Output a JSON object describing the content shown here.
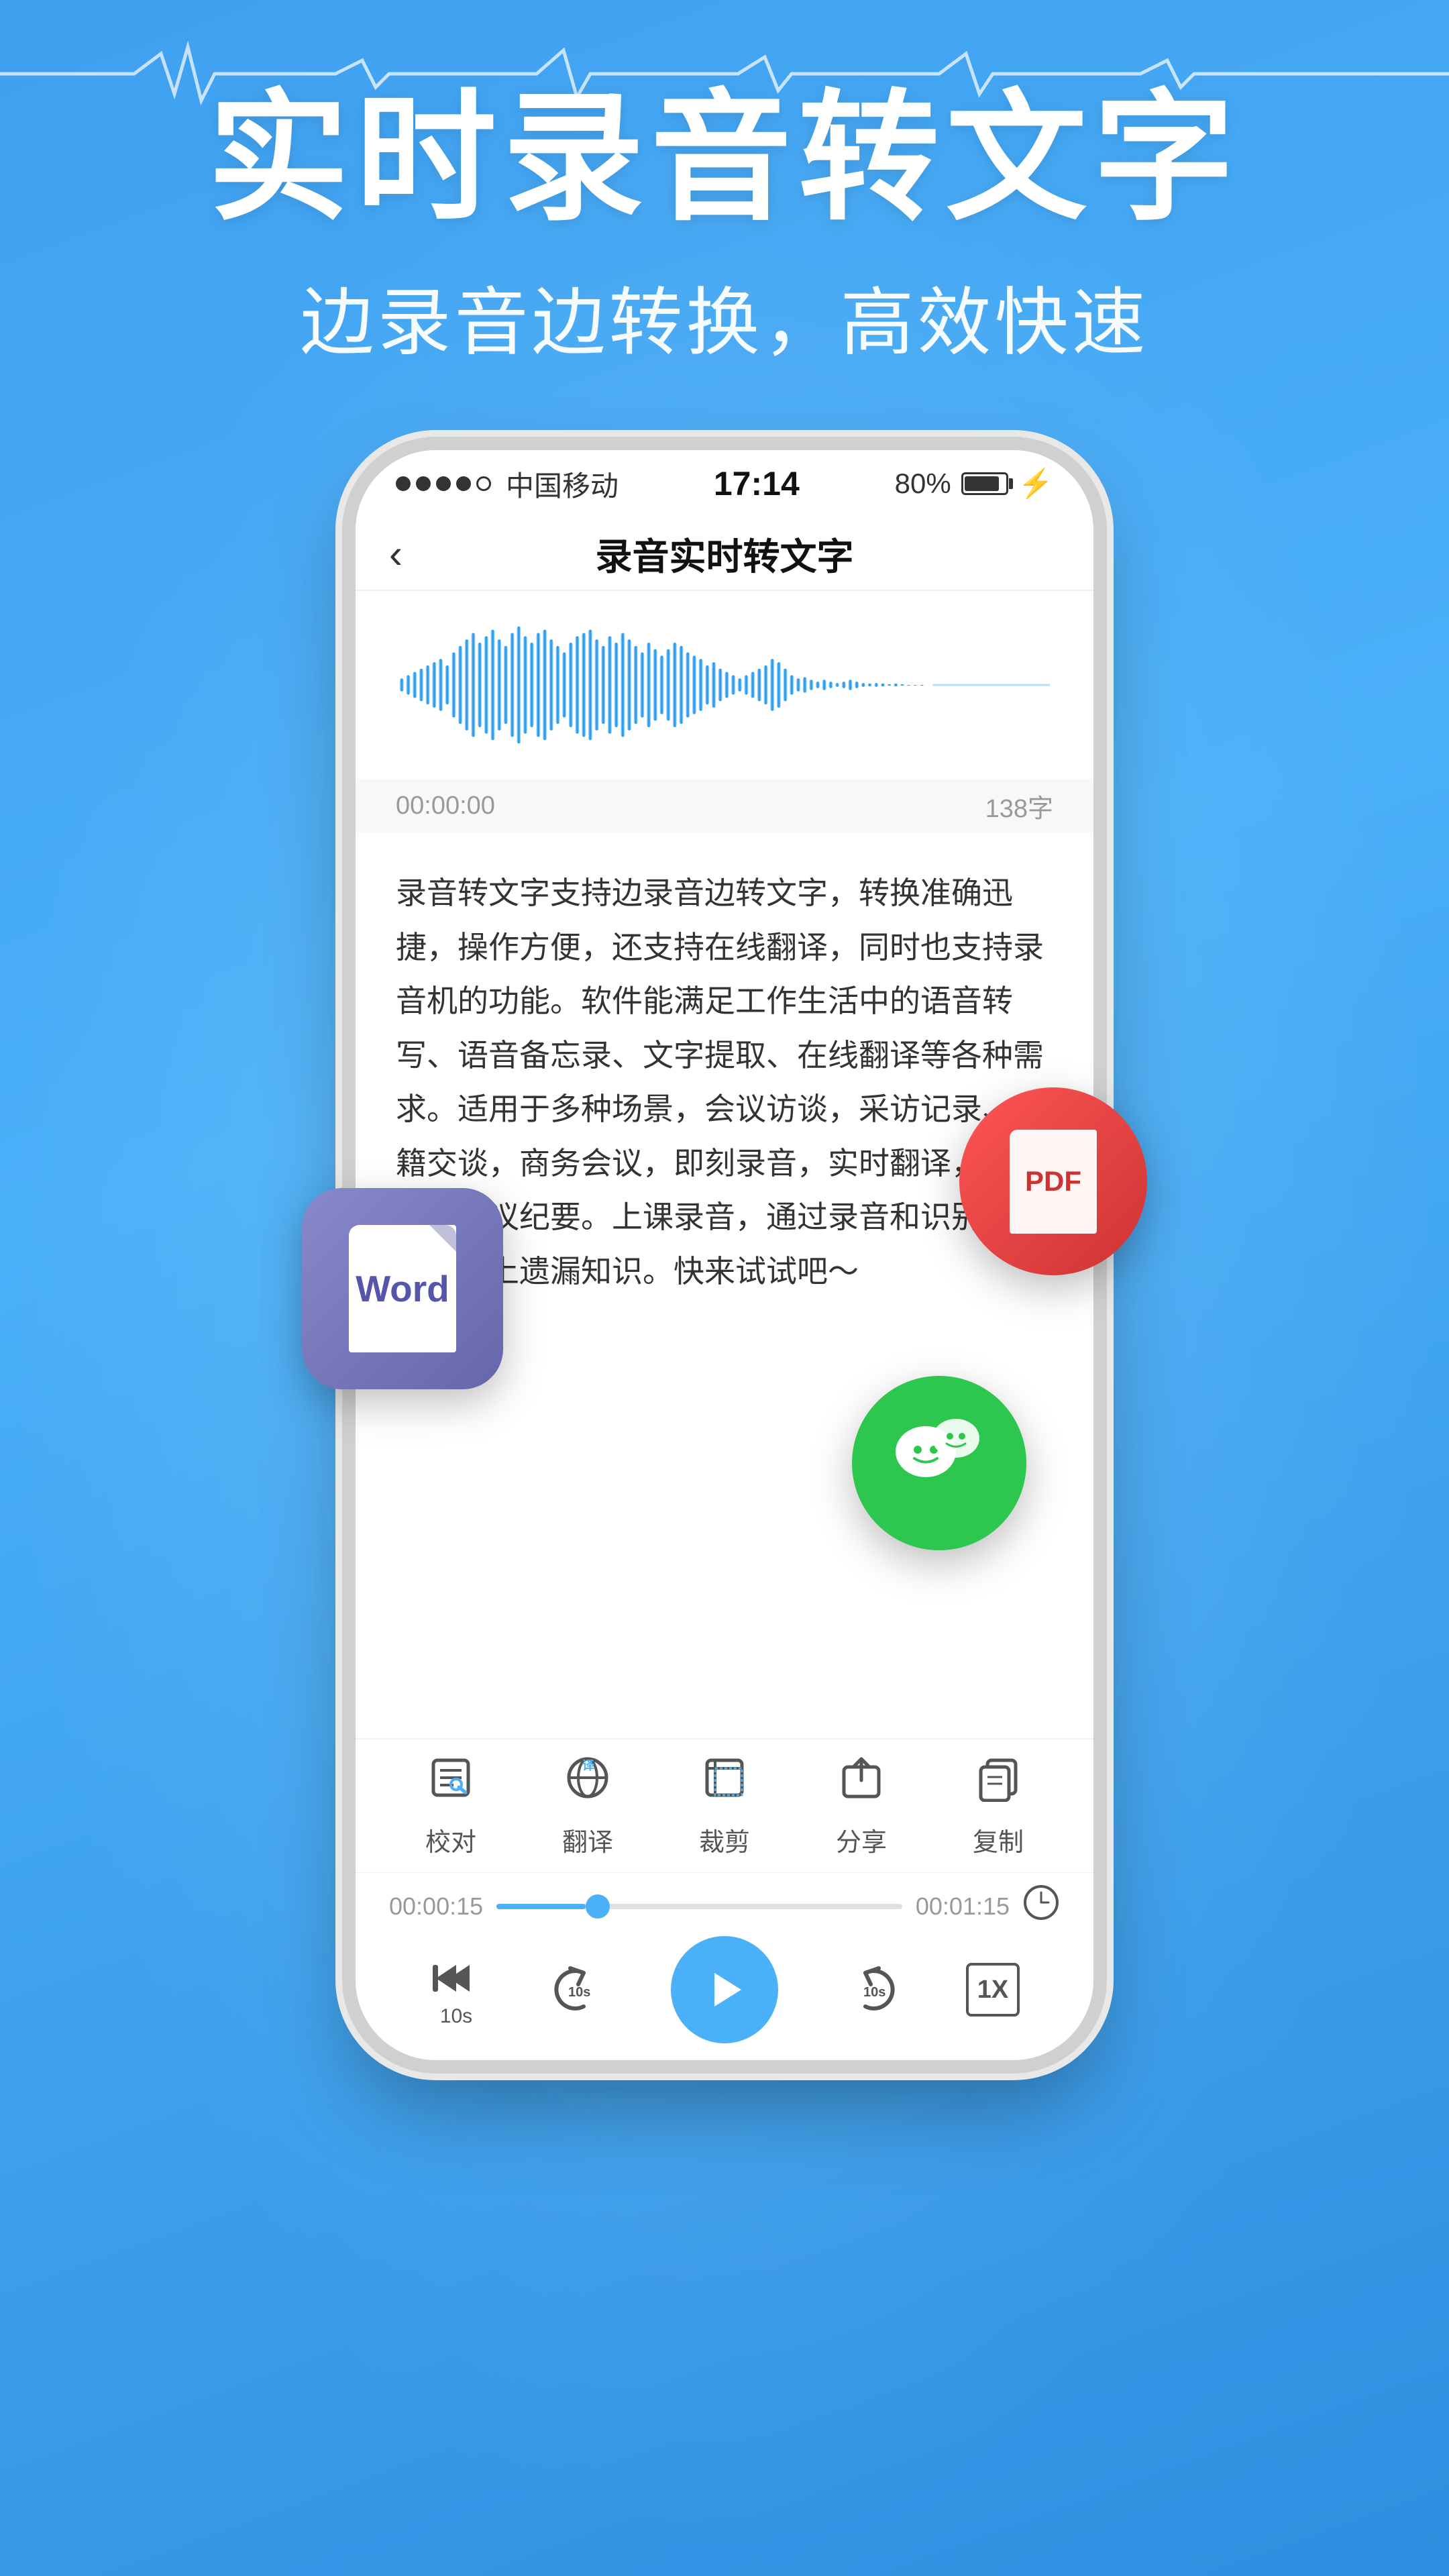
{
  "background_color": "#4ab0f8",
  "header": {
    "main_title": "实时录音转文字",
    "sub_title": "边录音边转换，高效快速"
  },
  "status_bar": {
    "signal": "•••○",
    "carrier": "中国移动",
    "time": "17:14",
    "battery_percent": "80%",
    "battery_label": "80%"
  },
  "nav": {
    "back_icon": "‹",
    "title": "录音实时转文字"
  },
  "recording": {
    "time_display": "00:00:00",
    "char_count": "138字"
  },
  "content_text": "录音转文字支持边录音边转文字，转换准确迅捷，操作方便，还支持在线翻译，同时也支持录音机的功能。软件能满足工作生活中的语音转写、语音备忘录、文字提取、在线翻译等各种需求。适用于多种场景，会议访谈，采访记录、外籍交谈，商务会议，即刻录音，实时翻译，轻松记录会议纪要。上课录音，通过录音和识别文字填补课上遗漏知识。快来试试吧～",
  "toolbar": {
    "items": [
      {
        "id": "proofread",
        "icon": "✏️",
        "label": "校对"
      },
      {
        "id": "translate",
        "icon": "🔄",
        "label": "翻译"
      },
      {
        "id": "trim",
        "icon": "✂️",
        "label": "裁剪"
      },
      {
        "id": "share",
        "icon": "📤",
        "label": "分享"
      },
      {
        "id": "copy",
        "icon": "📋",
        "label": "复制"
      }
    ]
  },
  "progress": {
    "current_time": "00:00:15",
    "total_time": "00:01:15",
    "fill_percent": 22
  },
  "playback": {
    "rewind_label": "",
    "rewind_seconds": "10s",
    "forward_label": "",
    "forward_seconds": "10s",
    "play_icon": "▶",
    "speed_label": "1X"
  },
  "badges": {
    "word": {
      "label": "Word"
    },
    "pdf": {
      "label": "PDF"
    },
    "wechat": {
      "label": ""
    }
  }
}
